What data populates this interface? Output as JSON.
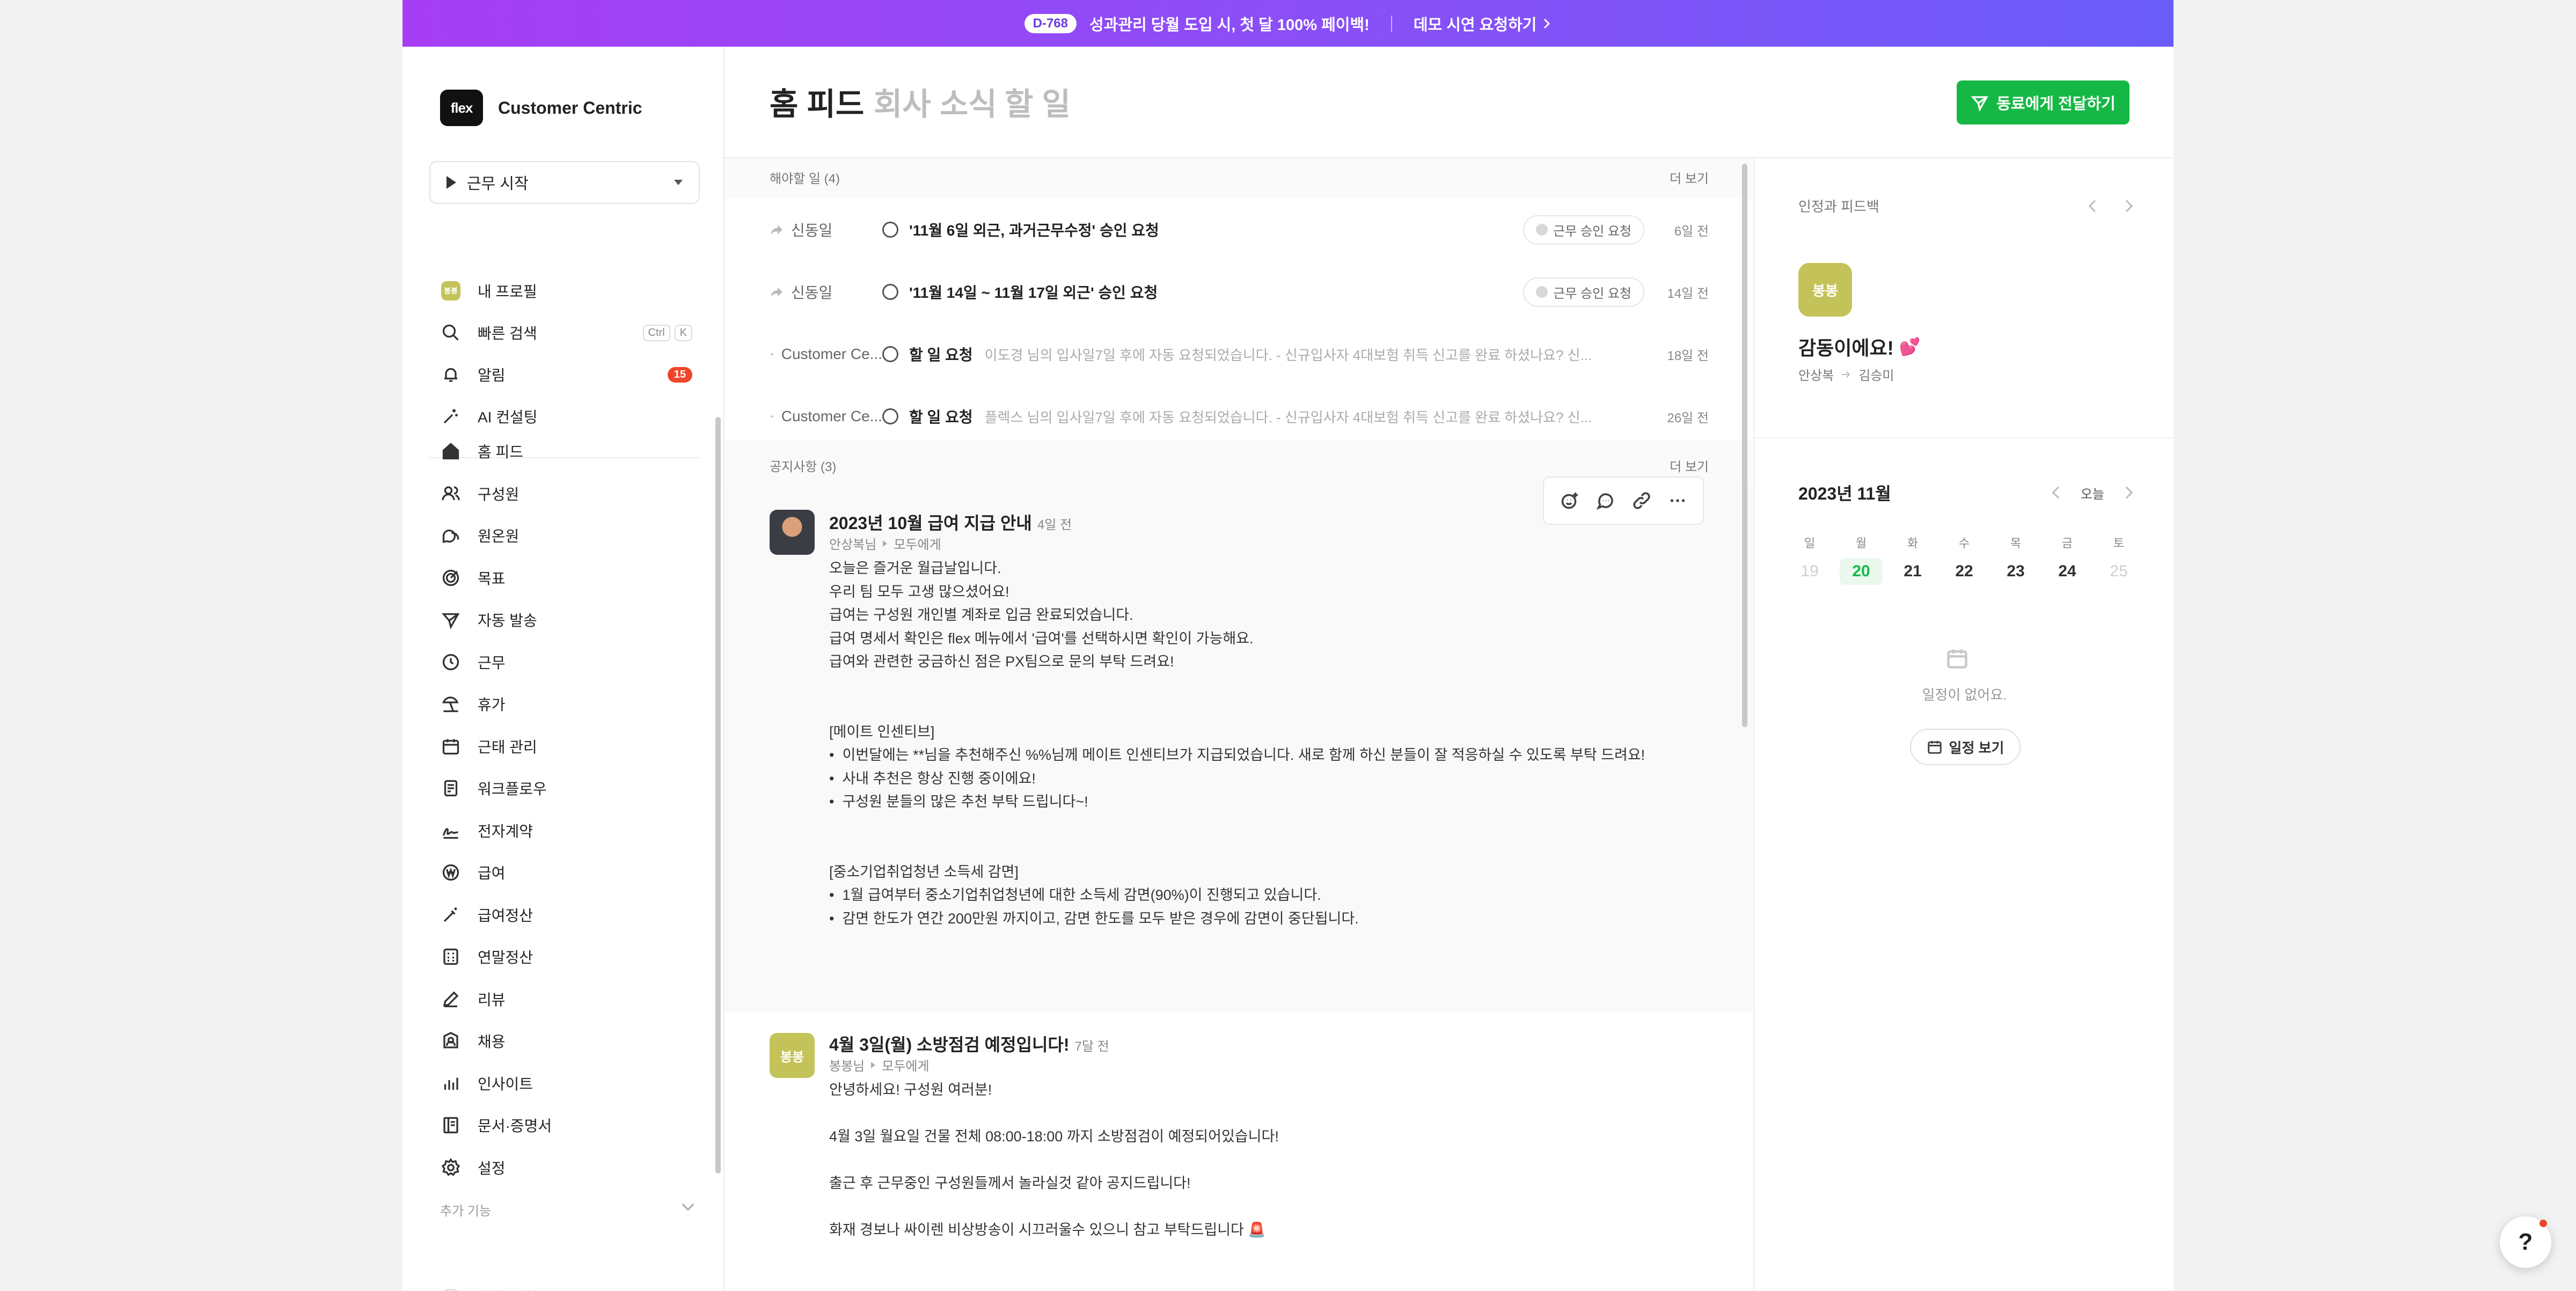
{
  "promo": {
    "dday": "D-768",
    "text": "성과관리 당월 도입 시, 첫 달 100% 페이백!",
    "demo": "데모 시연 요청하기"
  },
  "sidebar": {
    "logo": "flex",
    "company": "Customer Centric",
    "work_start": "근무 시작",
    "top_items": [
      {
        "label": "내 프로필",
        "avatar": "봉봉"
      },
      {
        "label": "빠른 검색",
        "kbd1": "Ctrl",
        "kbd2": "K"
      },
      {
        "label": "알림",
        "badge": "15"
      },
      {
        "label": "AI 컨설팅"
      }
    ],
    "items": [
      {
        "label": "홈 피드"
      },
      {
        "label": "구성원"
      },
      {
        "label": "원온원"
      },
      {
        "label": "목표"
      },
      {
        "label": "자동 발송"
      },
      {
        "label": "근무"
      },
      {
        "label": "휴가"
      },
      {
        "label": "근태 관리"
      },
      {
        "label": "워크플로우"
      },
      {
        "label": "전자계약"
      },
      {
        "label": "급여"
      },
      {
        "label": "급여정산"
      },
      {
        "label": "연말정산"
      },
      {
        "label": "리뷰"
      },
      {
        "label": "채용"
      },
      {
        "label": "인사이트"
      },
      {
        "label": "문서·증명서"
      },
      {
        "label": "설정"
      }
    ],
    "extra_label": "추가 기능",
    "faded_item": "단박 보험"
  },
  "header": {
    "tabs": [
      "홈 피드",
      "회사 소식",
      "할 일"
    ],
    "forward_button": "동료에게 전달하기"
  },
  "feed": {
    "todo_header": "해야할 일 (4)",
    "todo_more": "더 보기",
    "todos": [
      {
        "sender": "신동일",
        "title": "'11월 6일 외근, 과거근무수정' 승인 요청",
        "desc": "",
        "tag": "근무 승인 요청",
        "time": "6일 전"
      },
      {
        "sender": "신동일",
        "title": "'11월 14일 ~ 11월 17일 외근' 승인 요청",
        "desc": "",
        "tag": "근무 승인 요청",
        "time": "14일 전"
      },
      {
        "sender": "Customer Ce...",
        "title": "할 일 요청",
        "desc": "이도경 님의 입사일7일 후에 자동 요청되었습니다. - 신규입사자 4대보험 취득 신고를 완료 하셨나요? 신...",
        "tag": "",
        "time": "18일 전"
      },
      {
        "sender": "Customer Ce...",
        "title": "할 일 요청",
        "desc": "플렉스 님의 입사일7일 후에 자동 요청되었습니다. - 신규입사자 4대보험 취득 신고를 완료 하셨나요? 신...",
        "tag": "",
        "time": "26일 전"
      }
    ],
    "notice_header": "공지사항 (3)",
    "notice_more": "더 보기",
    "posts": [
      {
        "title": "2023년 10월 급여 지급 안내",
        "ago": "4일 전",
        "author": "안상복님",
        "audience": "모두에게",
        "body": "오늘은 즐거운 월급날입니다.\n우리 팀 모두 고생 많으셨어요!\n급여는 구성원 개인별 계좌로 입금 완료되었습니다.\n급여 명세서 확인은 flex 메뉴에서 '급여'를 선택하시면 확인이 가능해요.\n급여와 관련한 궁금하신 점은 PX팀으로 문의 부탁 드려요!\n\n\n[메이트 인센티브]\n•  이번달에는 **님을 추천해주신 %%님께 메이트 인센티브가 지급되었습니다. 새로 함께 하신 분들이 잘 적응하실 수 있도록 부탁 드려요!\n•  사내 추천은 항상 진행 중이에요!\n•  구성원 분들의 많은 추천 부탁 드립니다~!\n\n\n[중소기업취업청년 소득세 감면]\n•  1월 급여부터 중소기업취업청년에 대한 소득세 감면(90%)이 진행되고 있습니다.\n•  감면 한도가 연간 200만원 까지이고, 감면 한도를 모두 받은 경우에 감면이 중단됩니다."
      },
      {
        "avatar": "봉봉",
        "title": "4월 3일(월) 소방점검 예정입니다!",
        "ago": "7달 전",
        "author": "봉봉님",
        "audience": "모두에게",
        "body": "안녕하세요! 구성원 여러분!\n\n4월 3일 월요일 건물 전체 08:00-18:00 까지 소방점검이 예정되어있습니다!\n\n출근 후 근무중인 구성원들께서 놀라실것 같아 공지드립니다!\n\n화재 경보나 싸이렌 비상방송이 시끄러울수 있으니 참고 부탁드립니다 🚨"
      }
    ]
  },
  "right": {
    "praise_header": "인정과 피드백",
    "praise_avatar": "봉봉",
    "praise_text": "감동이에요!",
    "praise_from": "안상복",
    "praise_to": "김승미",
    "cal_month": "2023년 11월",
    "cal_today_label": "오늘",
    "weekdays": [
      "일",
      "월",
      "화",
      "수",
      "목",
      "금",
      "토"
    ],
    "days": [
      "19",
      "20",
      "21",
      "22",
      "23",
      "24",
      "25"
    ],
    "empty_text": "일정이 없어요.",
    "schedule_button": "일정 보기"
  },
  "help": "?"
}
